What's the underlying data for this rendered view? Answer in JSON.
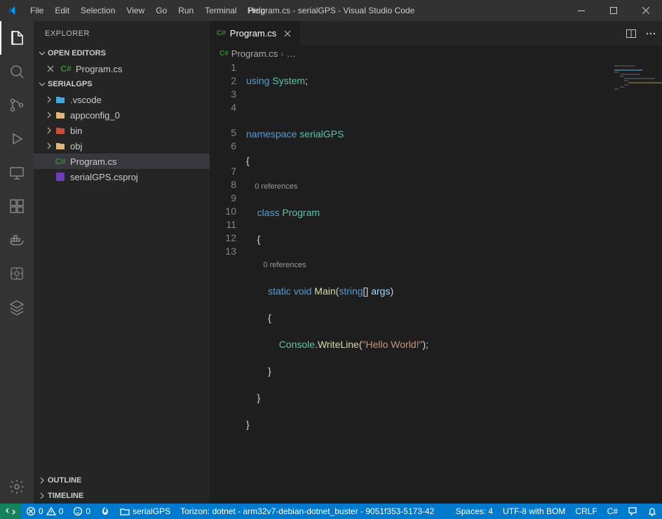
{
  "title": "Program.cs - serialGPS - Visual Studio Code",
  "menubar": [
    "File",
    "Edit",
    "Selection",
    "View",
    "Go",
    "Run",
    "Terminal",
    "Help"
  ],
  "sidebar": {
    "title": "EXPLORER",
    "openEditors": {
      "label": "OPEN EDITORS",
      "items": [
        {
          "name": "Program.cs",
          "lang": "C#"
        }
      ]
    },
    "project": {
      "label": "SERIALGPS",
      "items": [
        {
          "name": ".vscode",
          "type": "folder-vs"
        },
        {
          "name": "appconfig_0",
          "type": "folder-y"
        },
        {
          "name": "bin",
          "type": "folder-r"
        },
        {
          "name": "obj",
          "type": "folder-y"
        },
        {
          "name": "Program.cs",
          "type": "cs",
          "selected": true
        },
        {
          "name": "serialGPS.csproj",
          "type": "csproj"
        }
      ]
    },
    "outline": "OUTLINE",
    "timeline": "TIMELINE"
  },
  "tab": {
    "name": "Program.cs"
  },
  "breadcrumb": {
    "file": "Program.cs",
    "more": "…"
  },
  "codelens": {
    "ref0": "0 references",
    "ref1": "0 references"
  },
  "code": {
    "l1": {
      "a": "using",
      "b": "System",
      "c": ";"
    },
    "l3": {
      "a": "namespace",
      "b": "serialGPS"
    },
    "l4": "{",
    "l5": {
      "a": "class",
      "b": "Program"
    },
    "l6": "    {",
    "l7": {
      "a": "static",
      "b": "void",
      "c": "Main",
      "d": "(",
      "e": "string",
      "f": "[] ",
      "g": "args",
      "h": ")"
    },
    "l8": "        {",
    "l9": {
      "a": "Console",
      "b": ".",
      "c": "WriteLine",
      "d": "(",
      "e": "\"Hello World!\"",
      "f": ");"
    },
    "l10": "        }",
    "l11": "    }",
    "l12": "}",
    "l13": ""
  },
  "lineno": [
    "1",
    "2",
    "3",
    "4",
    "5",
    "6",
    "7",
    "8",
    "9",
    "10",
    "11",
    "12",
    "13"
  ],
  "statusbar": {
    "errors": "0",
    "warnings": "0",
    "ports": "0",
    "project": "serialGPS",
    "torizon": "Torizon: dotnet - arm32v7-debian-dotnet_buster - 9051f353-5173-42",
    "spaces": "Spaces: 4",
    "encoding": "UTF-8 with BOM",
    "eol": "CRLF",
    "lang": "C#"
  }
}
